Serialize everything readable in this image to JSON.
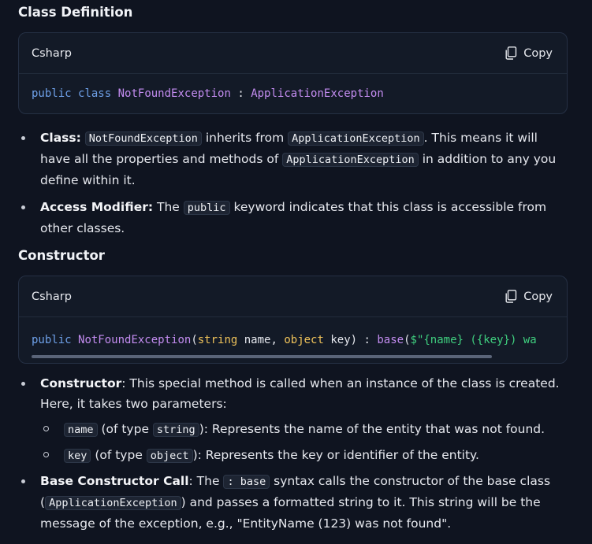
{
  "sections": [
    {
      "heading": "Class Definition",
      "code_lang": "Csharp",
      "copy_label": "Copy",
      "code_tokens": [
        "public",
        " ",
        "class",
        " ",
        "NotFoundException",
        " : ",
        "ApplicationException"
      ]
    },
    {
      "heading": "Constructor",
      "code_lang": "Csharp",
      "copy_label": "Copy",
      "code_tokens": [
        "public",
        " ",
        "NotFoundException",
        "(",
        "string",
        " name, ",
        "object",
        " key) : ",
        "base",
        "(",
        "$\"{name} ({key}) wa"
      ]
    }
  ],
  "class_bullets": {
    "b1": {
      "label": "Class",
      "colon": ":",
      "code1": "NotFoundException",
      "t1": " inherits from ",
      "code2": "ApplicationException",
      "t2": ". This means it will have all the properties and methods of ",
      "code3": "ApplicationException",
      "t3": " in addition to any you define within it."
    },
    "b2": {
      "label": "Access Modifier",
      "colon": ":",
      "t1": " The ",
      "code1": "public",
      "t2": " keyword indicates that this class is accessible from other classes."
    }
  },
  "ctor_bullets": {
    "b1": {
      "label": "Constructor",
      "t1": ": This special method is called when an instance of the class is created. Here, it takes two parameters:",
      "sub1": {
        "code1": "name",
        "t1": " (of type ",
        "code2": "string",
        "t2": "): Represents the name of the entity that was not found."
      },
      "sub2": {
        "code1": "key",
        "t1": " (of type ",
        "code2": "object",
        "t2": "): Represents the key or identifier of the entity."
      }
    },
    "b2": {
      "label": "Base Constructor Call",
      "t1": ": The ",
      "code1": ": base",
      "t2": " syntax calls the constructor of the base class (",
      "code2": "ApplicationException",
      "t3": ") and passes a formatted string to it. This string will be the message of the exception, e.g., \"EntityName (123) was not found\"."
    }
  },
  "colors": {
    "keyword": "#6ea0e8",
    "class_name": "#c38cf0",
    "type": "#f0c35a",
    "string": "#3fcf7f",
    "background": "#0f1420"
  }
}
